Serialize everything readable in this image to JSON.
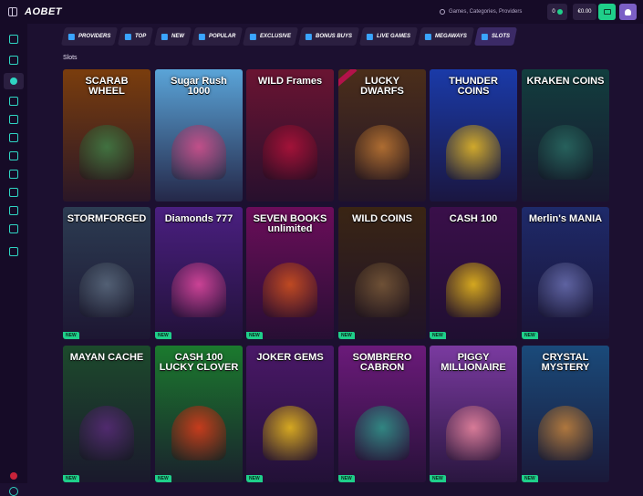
{
  "header": {
    "logo": "AOBET",
    "search_placeholder": "Games, Categories, Providers",
    "bonus_value": "0",
    "balance": "€0.00"
  },
  "categories": [
    {
      "label": "Providers",
      "icon": "grid-icon",
      "color": "#3aa4ff"
    },
    {
      "label": "Top",
      "icon": "rocket-icon",
      "color": "#3aa4ff"
    },
    {
      "label": "New",
      "icon": "new-icon",
      "color": "#3aa4ff"
    },
    {
      "label": "Popular",
      "icon": "fire-icon",
      "color": "#3aa4ff"
    },
    {
      "label": "Exclusive",
      "icon": "crown-icon",
      "color": "#3aa4ff"
    },
    {
      "label": "Bonus Buys",
      "icon": "bag-icon",
      "color": "#3aa4ff"
    },
    {
      "label": "Live Games",
      "icon": "live-icon",
      "color": "#3aa4ff"
    },
    {
      "label": "Megaways",
      "icon": "megaways-icon",
      "color": "#3aa4ff"
    },
    {
      "label": "Slots",
      "icon": "slots-icon",
      "color": "#3aa4ff"
    }
  ],
  "section_title": "Slots",
  "games": [
    {
      "title": "SCARAB WHEEL",
      "bg": "#7a3d0d",
      "art": "#3f7f47",
      "new": false,
      "ribbon": false
    },
    {
      "title": "Sugar Rush 1000",
      "bg": "#5aa4d8",
      "art": "#d94d8a",
      "new": false,
      "ribbon": false
    },
    {
      "title": "WILD Frames",
      "bg": "#6a1432",
      "art": "#b3123a",
      "new": false,
      "ribbon": false
    },
    {
      "title": "LUCKY DWARFS",
      "bg": "#4b2e1a",
      "art": "#c37a34",
      "new": false,
      "ribbon": true
    },
    {
      "title": "THUNDER COINS",
      "bg": "#1a3aa8",
      "art": "#f0c020",
      "new": false,
      "ribbon": false
    },
    {
      "title": "KRAKEN COINS",
      "bg": "#123e3e",
      "art": "#2a6b63",
      "new": false,
      "ribbon": false
    },
    {
      "title": "STORMFORGED",
      "bg": "#2c3c52",
      "art": "#5b6a7e",
      "new": true,
      "ribbon": false
    },
    {
      "title": "Diamonds 777",
      "bg": "#4a1f80",
      "art": "#e64aa0",
      "new": true,
      "ribbon": false
    },
    {
      "title": "SEVEN BOOKS unlimited",
      "bg": "#6b0d5a",
      "art": "#d4541c",
      "new": true,
      "ribbon": false
    },
    {
      "title": "WILD COINS",
      "bg": "#3a2514",
      "art": "#7a5a3a",
      "new": true,
      "ribbon": false
    },
    {
      "title": "CASH 100",
      "bg": "#3a0f4a",
      "art": "#f2c21a",
      "new": true,
      "ribbon": false
    },
    {
      "title": "Merlin's MANIA",
      "bg": "#1e2a6a",
      "art": "#6a6fb0",
      "new": true,
      "ribbon": false
    },
    {
      "title": "MAYAN CACHE",
      "bg": "#1c4a2c",
      "art": "#5a2a7a",
      "new": true,
      "ribbon": false
    },
    {
      "title": "CASH 100 LUCKY CLOVER",
      "bg": "#1b7a2e",
      "art": "#e43a1a",
      "new": true,
      "ribbon": false
    },
    {
      "title": "JOKER GEMS",
      "bg": "#4a1868",
      "art": "#f2c21a",
      "new": true,
      "ribbon": false
    },
    {
      "title": "SOMBRERO CABRON",
      "bg": "#6b1a7a",
      "art": "#2e9a8a",
      "new": true,
      "ribbon": false
    },
    {
      "title": "PIGGY MILLIONAIRE",
      "bg": "#7a3aa0",
      "art": "#f08aa0",
      "new": true,
      "ribbon": false
    },
    {
      "title": "CRYSTAL MYSTERY",
      "bg": "#1a4a7a",
      "art": "#c9843a",
      "new": true,
      "ribbon": false
    }
  ],
  "leftnav_icons": [
    "compass-icon",
    "home-icon",
    "slots-icon",
    "casino-icon",
    "cards-icon",
    "bonus-icon",
    "live-icon",
    "chat-icon",
    "trophy-icon",
    "sport-icon",
    "gift-icon",
    "support-icon"
  ],
  "new_badge": "NEW"
}
